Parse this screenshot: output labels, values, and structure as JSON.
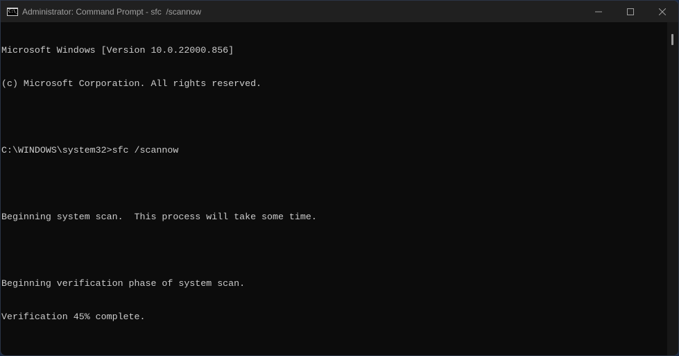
{
  "window": {
    "title": "Administrator: Command Prompt - sfc  /scannow",
    "icon": "command-prompt-icon",
    "icon_text": "C:\\_",
    "controls": {
      "minimize": "minimize-icon",
      "maximize": "maximize-icon",
      "close": "close-icon"
    }
  },
  "terminal": {
    "lines": [
      "Microsoft Windows [Version 10.0.22000.856]",
      "(c) Microsoft Corporation. All rights reserved.",
      "",
      "C:\\WINDOWS\\system32>sfc /scannow",
      "",
      "Beginning system scan.  This process will take some time.",
      "",
      "Beginning verification phase of system scan.",
      "Verification 45% complete."
    ],
    "background": "#0c0c0c",
    "foreground": "#cccccc"
  }
}
